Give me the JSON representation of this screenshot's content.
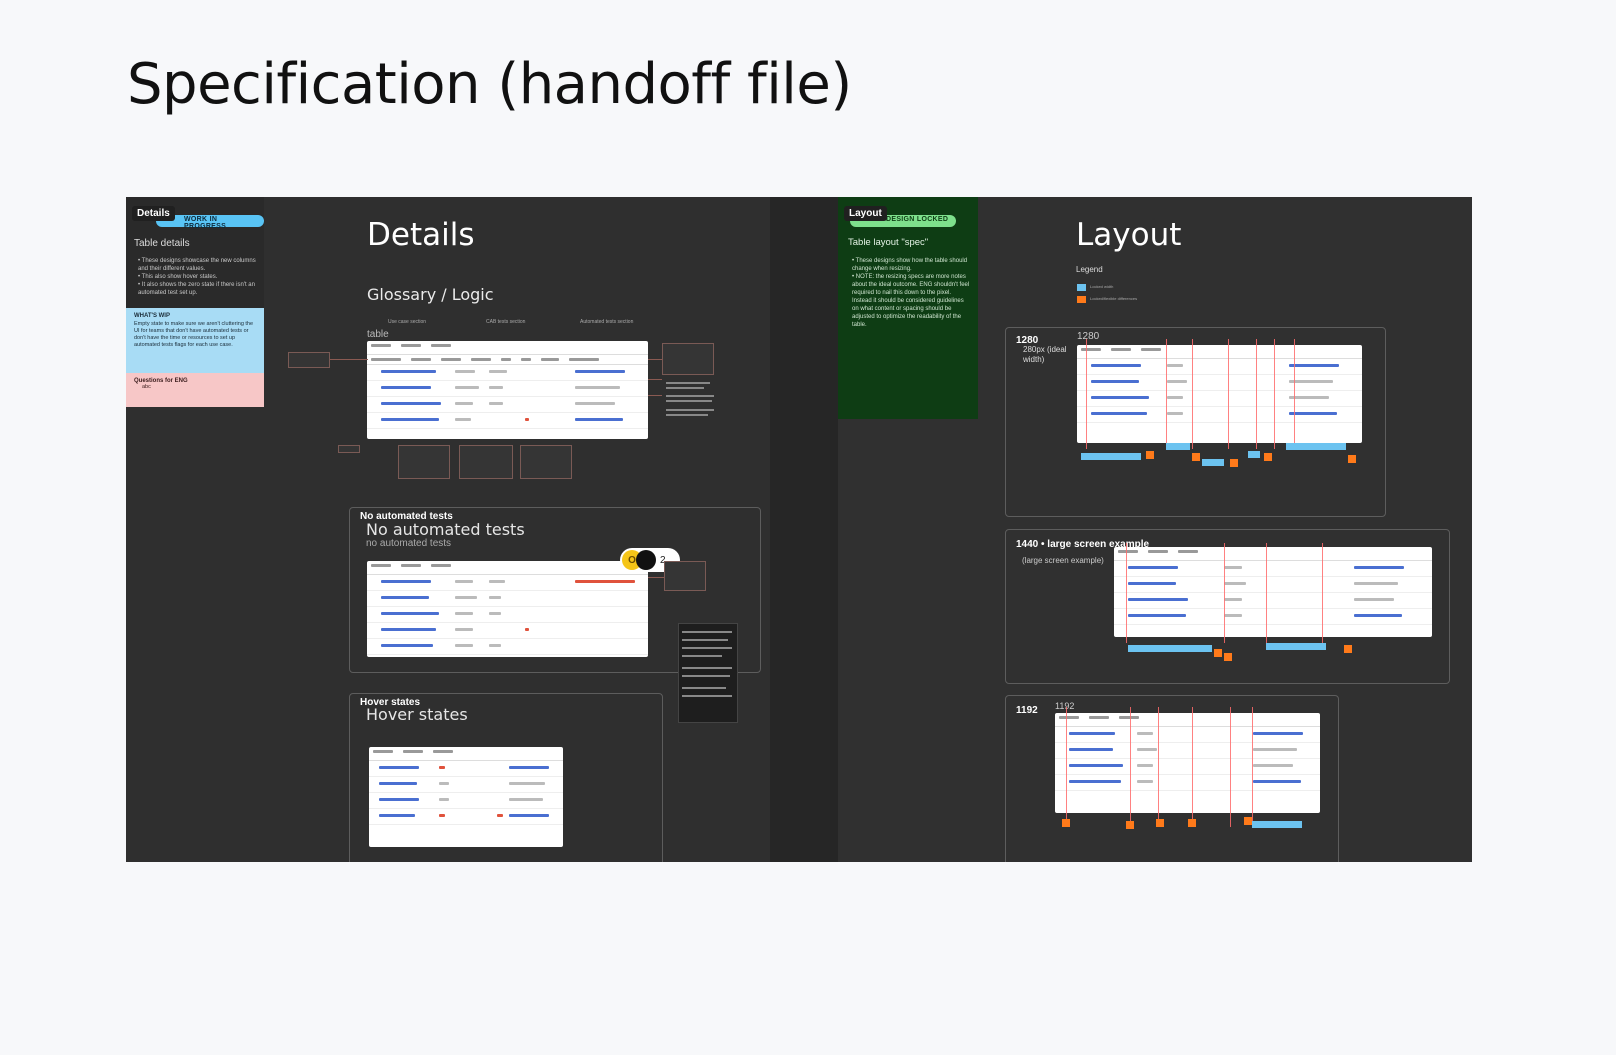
{
  "page_title": "Specification (handoff file)",
  "left": {
    "note": {
      "tag": "Details",
      "pill": "WORK IN PROGRESS",
      "title": "Table details",
      "bullets": [
        "These designs showcase the new columns and their different values.",
        "This also show hover states.",
        "It also shows the zero state if there isn't an automated test set up."
      ],
      "wip_title": "WHAT'S WIP",
      "wip_text": "Empty state to make sure we aren't cluttering the UI for teams that don't have automated tests or don't have the time or resources to set up automated tests flags for each use case.",
      "questions_title": "Questions for ENG",
      "questions_item": "abc"
    },
    "heading": "Details",
    "glossary": "Glossary / Logic",
    "table_label": "table",
    "col_labels": [
      "Use case section",
      "CAB tests section",
      "Automated tests section"
    ],
    "no_tests_frame_label": "No automated tests",
    "no_tests_heading": "No automated tests",
    "no_tests_sub": "no automated tests",
    "hover_frame_label": "Hover states",
    "hover_heading": "Hover states",
    "avatars": {
      "initial": "O",
      "count": "2"
    }
  },
  "right": {
    "note": {
      "tag": "Layout",
      "pill": "DESIGN LOCKED",
      "title": "Table layout \"spec\"",
      "bullets": [
        "These designs show how the table should change when resizing.",
        "NOTE: the resizing specs are more notes about the ideal outcome. ENG shouldn't feel required to nail this down to the pixel. Instead it should be considered guidelines on what content or spacing should be adjusted to optimize the readability of the table."
      ]
    },
    "heading": "Layout",
    "legend": "Legend",
    "legend_items": [
      "Locked width",
      "Locked/flexible differences"
    ],
    "frames": [
      {
        "label": "1280",
        "sub": "1280",
        "extra": "280px (ideal width)"
      },
      {
        "label": "1440 • large screen example",
        "sub": "(large screen example)"
      },
      {
        "label": "1192",
        "sub": "1192"
      }
    ]
  },
  "colors": {
    "canvas": "#2f2f2f",
    "wip_blue": "#a8dcf5",
    "questions_pink": "#f7c7c7",
    "locked_green": "#0e3d14",
    "pill_blue": "#59c4f5",
    "pill_green": "#7ee08c",
    "accent_red": "#ff6b6b",
    "accent_orange": "#ff7a1a"
  }
}
